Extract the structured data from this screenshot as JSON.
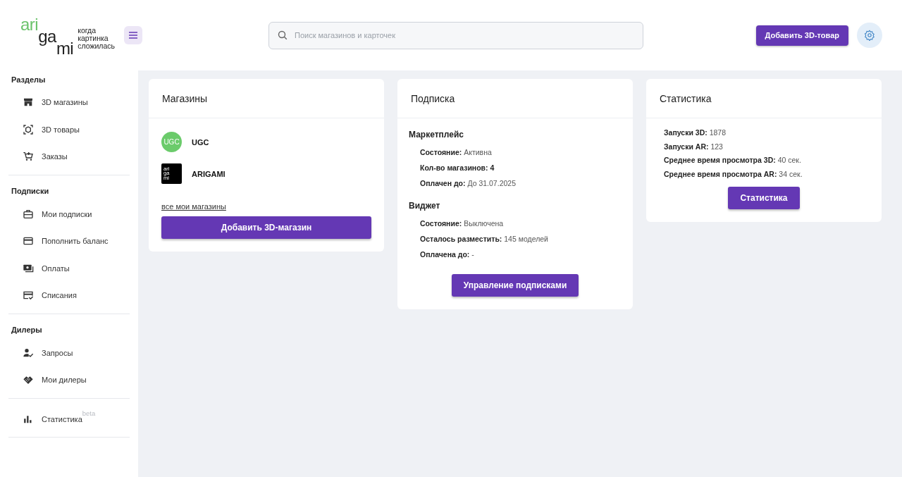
{
  "header": {
    "logo": {
      "parts": [
        "ari",
        "ga",
        "mi"
      ],
      "tagline": [
        "когда",
        "картинка",
        "сложилась"
      ]
    },
    "search": {
      "placeholder": "Поиск магазинов и карточек"
    },
    "add_button": "Добавить 3D-товар"
  },
  "sidebar": {
    "sections": [
      {
        "title": "Разделы",
        "items": [
          {
            "kind": "store",
            "label": "3D магазины"
          },
          {
            "kind": "cube",
            "label": "3D товары"
          },
          {
            "kind": "cart",
            "label": "Заказы"
          }
        ]
      },
      {
        "title": "Подписки",
        "items": [
          {
            "kind": "briefcase",
            "label": "Мои подписки"
          },
          {
            "kind": "card",
            "label": "Пополнить баланс"
          },
          {
            "kind": "payments",
            "label": "Оплаты"
          },
          {
            "kind": "card-check",
            "label": "Списания"
          }
        ]
      },
      {
        "title": "Дилеры",
        "items": [
          {
            "kind": "person-check",
            "label": "Запросы"
          },
          {
            "kind": "handshake",
            "label": "Мои дилеры"
          }
        ]
      },
      {
        "items": [
          {
            "kind": "bar-chart",
            "label": "Статистика",
            "badge": "beta"
          }
        ]
      }
    ]
  },
  "cards": [
    {
      "kind": "shops",
      "title": "Магазины",
      "shops": [
        {
          "kind": "circle",
          "avatar_lines": [
            "UGC"
          ],
          "color": "#6bcb6b",
          "name": "UGC"
        },
        {
          "kind": "square",
          "avatar_lines": [
            "ari",
            "ga",
            "mi"
          ],
          "color": "#000000",
          "name": "ARIGAMI"
        }
      ],
      "link": "все мои магазины",
      "button": "Добавить 3D-магазин"
    },
    {
      "kind": "subscription",
      "title": "Подписка",
      "groups": [
        {
          "title": "Маркетплейс",
          "rows": [
            "**Состояние:** Активна",
            {
              "text": "Кол-во магазинов: 4",
              "strong": true
            },
            "**Оплачен до:** До 31.07.2025"
          ]
        },
        {
          "title": "Виджет",
          "rows": [
            "**Состояние:** Выключена",
            "**Осталось разместить:** 145 моделей",
            "**Оплачена до:** -"
          ]
        }
      ],
      "button": "Управление подписками"
    },
    {
      "kind": "stats",
      "title": "Статистика",
      "rows": [
        "**Запуски 3D:** 1878",
        "**Запуски AR:** 123",
        "**Среднее время просмотра 3D:** 40 сек.",
        "**Среднее время просмотра AR:** 34 сек."
      ],
      "button": "Статистика"
    }
  ]
}
